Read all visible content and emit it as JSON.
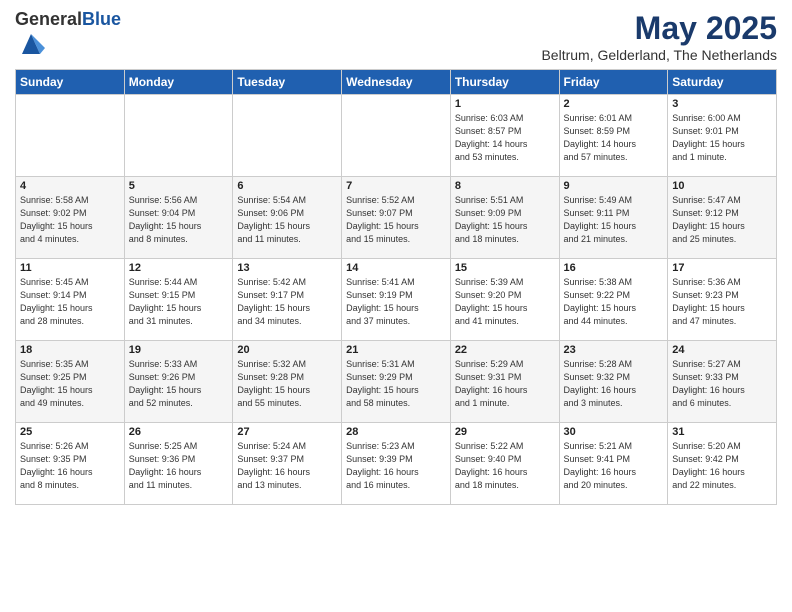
{
  "header": {
    "logo_general": "General",
    "logo_blue": "Blue",
    "title": "May 2025",
    "subtitle": "Beltrum, Gelderland, The Netherlands"
  },
  "weekdays": [
    "Sunday",
    "Monday",
    "Tuesday",
    "Wednesday",
    "Thursday",
    "Friday",
    "Saturday"
  ],
  "weeks": [
    [
      {
        "day": "",
        "info": ""
      },
      {
        "day": "",
        "info": ""
      },
      {
        "day": "",
        "info": ""
      },
      {
        "day": "",
        "info": ""
      },
      {
        "day": "1",
        "info": "Sunrise: 6:03 AM\nSunset: 8:57 PM\nDaylight: 14 hours\nand 53 minutes."
      },
      {
        "day": "2",
        "info": "Sunrise: 6:01 AM\nSunset: 8:59 PM\nDaylight: 14 hours\nand 57 minutes."
      },
      {
        "day": "3",
        "info": "Sunrise: 6:00 AM\nSunset: 9:01 PM\nDaylight: 15 hours\nand 1 minute."
      }
    ],
    [
      {
        "day": "4",
        "info": "Sunrise: 5:58 AM\nSunset: 9:02 PM\nDaylight: 15 hours\nand 4 minutes."
      },
      {
        "day": "5",
        "info": "Sunrise: 5:56 AM\nSunset: 9:04 PM\nDaylight: 15 hours\nand 8 minutes."
      },
      {
        "day": "6",
        "info": "Sunrise: 5:54 AM\nSunset: 9:06 PM\nDaylight: 15 hours\nand 11 minutes."
      },
      {
        "day": "7",
        "info": "Sunrise: 5:52 AM\nSunset: 9:07 PM\nDaylight: 15 hours\nand 15 minutes."
      },
      {
        "day": "8",
        "info": "Sunrise: 5:51 AM\nSunset: 9:09 PM\nDaylight: 15 hours\nand 18 minutes."
      },
      {
        "day": "9",
        "info": "Sunrise: 5:49 AM\nSunset: 9:11 PM\nDaylight: 15 hours\nand 21 minutes."
      },
      {
        "day": "10",
        "info": "Sunrise: 5:47 AM\nSunset: 9:12 PM\nDaylight: 15 hours\nand 25 minutes."
      }
    ],
    [
      {
        "day": "11",
        "info": "Sunrise: 5:45 AM\nSunset: 9:14 PM\nDaylight: 15 hours\nand 28 minutes."
      },
      {
        "day": "12",
        "info": "Sunrise: 5:44 AM\nSunset: 9:15 PM\nDaylight: 15 hours\nand 31 minutes."
      },
      {
        "day": "13",
        "info": "Sunrise: 5:42 AM\nSunset: 9:17 PM\nDaylight: 15 hours\nand 34 minutes."
      },
      {
        "day": "14",
        "info": "Sunrise: 5:41 AM\nSunset: 9:19 PM\nDaylight: 15 hours\nand 37 minutes."
      },
      {
        "day": "15",
        "info": "Sunrise: 5:39 AM\nSunset: 9:20 PM\nDaylight: 15 hours\nand 41 minutes."
      },
      {
        "day": "16",
        "info": "Sunrise: 5:38 AM\nSunset: 9:22 PM\nDaylight: 15 hours\nand 44 minutes."
      },
      {
        "day": "17",
        "info": "Sunrise: 5:36 AM\nSunset: 9:23 PM\nDaylight: 15 hours\nand 47 minutes."
      }
    ],
    [
      {
        "day": "18",
        "info": "Sunrise: 5:35 AM\nSunset: 9:25 PM\nDaylight: 15 hours\nand 49 minutes."
      },
      {
        "day": "19",
        "info": "Sunrise: 5:33 AM\nSunset: 9:26 PM\nDaylight: 15 hours\nand 52 minutes."
      },
      {
        "day": "20",
        "info": "Sunrise: 5:32 AM\nSunset: 9:28 PM\nDaylight: 15 hours\nand 55 minutes."
      },
      {
        "day": "21",
        "info": "Sunrise: 5:31 AM\nSunset: 9:29 PM\nDaylight: 15 hours\nand 58 minutes."
      },
      {
        "day": "22",
        "info": "Sunrise: 5:29 AM\nSunset: 9:31 PM\nDaylight: 16 hours\nand 1 minute."
      },
      {
        "day": "23",
        "info": "Sunrise: 5:28 AM\nSunset: 9:32 PM\nDaylight: 16 hours\nand 3 minutes."
      },
      {
        "day": "24",
        "info": "Sunrise: 5:27 AM\nSunset: 9:33 PM\nDaylight: 16 hours\nand 6 minutes."
      }
    ],
    [
      {
        "day": "25",
        "info": "Sunrise: 5:26 AM\nSunset: 9:35 PM\nDaylight: 16 hours\nand 8 minutes."
      },
      {
        "day": "26",
        "info": "Sunrise: 5:25 AM\nSunset: 9:36 PM\nDaylight: 16 hours\nand 11 minutes."
      },
      {
        "day": "27",
        "info": "Sunrise: 5:24 AM\nSunset: 9:37 PM\nDaylight: 16 hours\nand 13 minutes."
      },
      {
        "day": "28",
        "info": "Sunrise: 5:23 AM\nSunset: 9:39 PM\nDaylight: 16 hours\nand 16 minutes."
      },
      {
        "day": "29",
        "info": "Sunrise: 5:22 AM\nSunset: 9:40 PM\nDaylight: 16 hours\nand 18 minutes."
      },
      {
        "day": "30",
        "info": "Sunrise: 5:21 AM\nSunset: 9:41 PM\nDaylight: 16 hours\nand 20 minutes."
      },
      {
        "day": "31",
        "info": "Sunrise: 5:20 AM\nSunset: 9:42 PM\nDaylight: 16 hours\nand 22 minutes."
      }
    ]
  ]
}
